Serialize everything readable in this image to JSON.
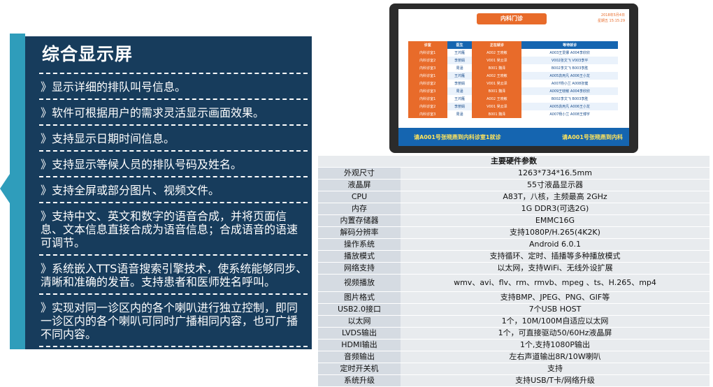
{
  "panel": {
    "title": "综合显示屏",
    "features": [
      "》显示详细的排队叫号信息。",
      "》软件可根据用户的需求灵活显示画面效果。",
      "》支持显示日期时间信息。",
      "》支持显示等候人员的排队号码及姓名。",
      "》支持全屏或部分图片、视频文件。",
      "》支持中文、英文和数字的语音合成，并将页面信息、文本信息直接合成为语音信息；合成语音的语速可调节。",
      "》系统嵌入TTS语音搜索引擎技术，使系统能够同步、清晰和准确的发音。支持患者和医师姓名呼叫。",
      "》实现对同一诊区内的各个喇叭进行独立控制，即同一诊区内的各个喇叭可同时广播相同内容，也可广播不同内容。"
    ]
  },
  "monitor": {
    "title": "内科门诊",
    "date": "2018年5月4日",
    "time": "星期五 15:15:29",
    "headers": [
      "诊室",
      "医生",
      "正在就诊",
      "等待就诊"
    ],
    "rows": [
      [
        "内科诊室1",
        "王鸿雁",
        "A002 王晓敏",
        "A003王爱娜  A004李欣欣"
      ],
      [
        "内科诊室2",
        "李丽娟",
        "V001 吴云泽",
        "V002张文飞  V003李平"
      ],
      [
        "内科诊室3",
        "周涵",
        "B001 魏泽",
        "B002李文飞  B003李胜"
      ],
      [
        "内科诊室1",
        "王鸿雁",
        "A002 王晓敏",
        "A005袁丙凡  A006王小龙"
      ],
      [
        "内科诊室2",
        "李丽娟",
        "V001 吴云泽",
        "A007杨小兰  A008张健"
      ],
      [
        "内科诊室3",
        "周涵",
        "B001 魏泽",
        "A009王晓敏  A004李欣欣"
      ],
      [
        "内科诊室1",
        "王鸿雁",
        "A002 王晓敏",
        "B002李文飞  B003李胜"
      ],
      [
        "内科诊室2",
        "李丽娟",
        "V001 吴云泽",
        "A005袁丙凡  A006王小龙"
      ],
      [
        "内科诊室3",
        "周涵",
        "B001 魏泽",
        "A007杨小兰  A008王博宇"
      ]
    ],
    "ticker_a": "请A001号张晓燕到内科诊室1就诊",
    "ticker_b": "请A001号张晓燕到内科"
  },
  "specs": {
    "title": "主要硬件参数",
    "rows": [
      {
        "key": "外观尺寸",
        "value": "1263*734*16.5mm"
      },
      {
        "key": "液晶屏",
        "value": "55寸液晶显示器"
      },
      {
        "key": "CPU",
        "value": "A83T，八核，主频最高 2GHz"
      },
      {
        "key": "内存",
        "value": "1G DDR3(可选2G)"
      },
      {
        "key": "内置存储器",
        "value": "EMMC16G"
      },
      {
        "key": "解码分辨率",
        "value": "支持1080P/H.265(4K2K)"
      },
      {
        "key": "操作系统",
        "value": "Android 6.0.1"
      },
      {
        "key": "播放模式",
        "value": "支持循环、定时、插播等多种播放模式"
      },
      {
        "key": "网络支持",
        "value": "以太网，支持WiFi、无线外设扩展"
      },
      {
        "key": "视频播放",
        "value": "wmv、avi、flv、rm、rmvb、mpeg 、ts、H.265、mp4"
      },
      {
        "key": "图片格式",
        "value": "支持BMP、JPEG、PNG、GIF等"
      },
      {
        "key": "USB2.0接口",
        "value": "7个USB HOST"
      },
      {
        "key": "以太网",
        "value": "1个，10M/100M自适应以太网"
      },
      {
        "key": "LVDS输出",
        "value": "1个，可直接驱动50/60Hz液晶屏"
      },
      {
        "key": "HDMI输出",
        "value": "1个,支持1080P输出"
      },
      {
        "key": "音频输出",
        "value": "左右声道输出8R/10W喇叭"
      },
      {
        "key": "定时开关机",
        "value": "支持"
      },
      {
        "key": "系统升级",
        "value": "支持USB/T卡/网络升级"
      }
    ]
  }
}
